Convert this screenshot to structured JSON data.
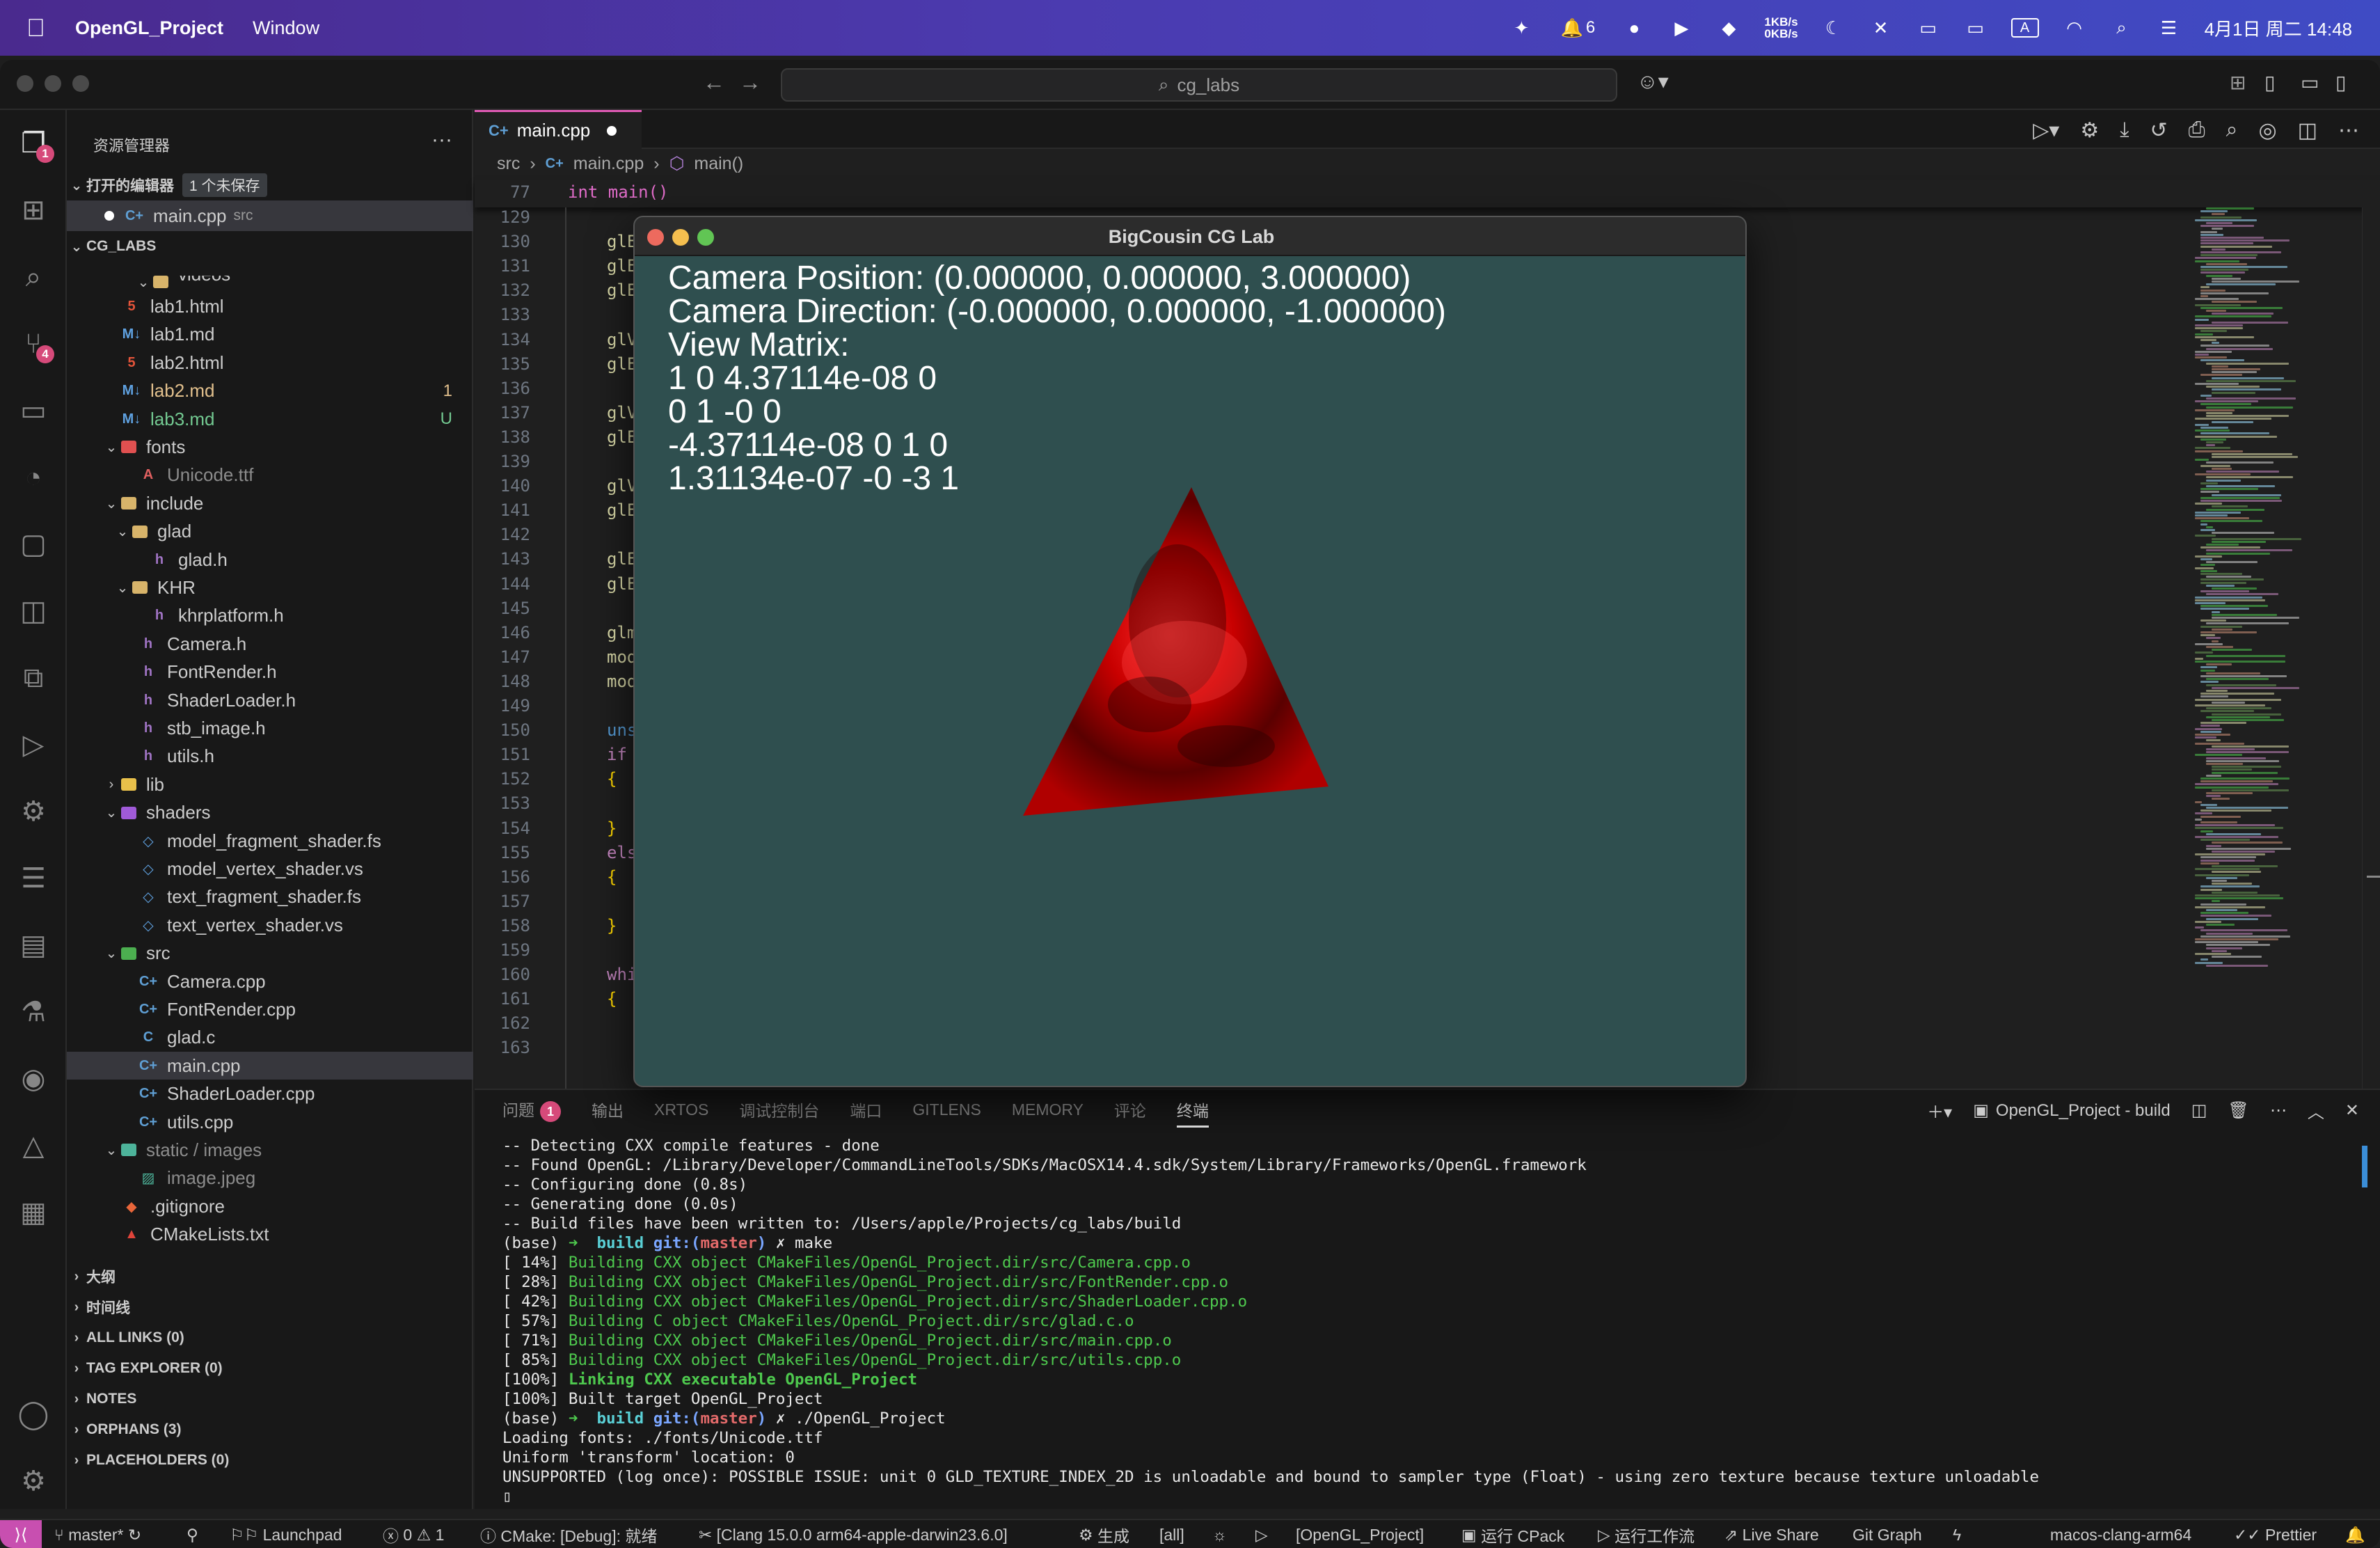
{
  "menubar": {
    "app_name": "OpenGL_Project",
    "menu_window": "Window",
    "network_up": "1KB/s",
    "network_down": "0KB/s",
    "notification_count": "6",
    "input_method": "A",
    "datetime": "4月1日 周二 14:48"
  },
  "titlebar": {
    "search_text": "cg_labs"
  },
  "activity_bar": {
    "explorer_badge": "1",
    "scm_badge": "4"
  },
  "sidebar": {
    "title": "资源管理器",
    "more": "···",
    "open_editors": {
      "label": "打开的编辑器",
      "unsaved_tag": "1 个未保存",
      "file": "main.cpp",
      "file_dir": "src"
    },
    "project": "CG_LABS",
    "tree": [
      {
        "name": "videos",
        "icon": "folder-icon"
      },
      {
        "name": "lab1.html",
        "icon": "html-file-icon"
      },
      {
        "name": "lab1.md",
        "icon": "markdown-file-icon"
      },
      {
        "name": "lab2.html",
        "icon": "html-file-icon"
      },
      {
        "name": "lab2.md",
        "icon": "markdown-file-icon",
        "status": "1"
      },
      {
        "name": "lab3.md",
        "icon": "markdown-file-icon",
        "status": "U"
      },
      {
        "name": "fonts",
        "icon": "folder-icon"
      },
      {
        "name": "Unicode.ttf",
        "icon": "font-file-icon"
      },
      {
        "name": "include",
        "icon": "folder-icon"
      },
      {
        "name": "glad",
        "icon": "folder-icon"
      },
      {
        "name": "glad.h",
        "icon": "header-file-icon"
      },
      {
        "name": "KHR",
        "icon": "folder-icon"
      },
      {
        "name": "khrplatform.h",
        "icon": "header-file-icon"
      },
      {
        "name": "Camera.h",
        "icon": "header-file-icon"
      },
      {
        "name": "FontRender.h",
        "icon": "header-file-icon"
      },
      {
        "name": "ShaderLoader.h",
        "icon": "header-file-icon"
      },
      {
        "name": "stb_image.h",
        "icon": "header-file-icon"
      },
      {
        "name": "utils.h",
        "icon": "header-file-icon"
      },
      {
        "name": "lib",
        "icon": "folder-icon"
      },
      {
        "name": "shaders",
        "icon": "folder-icon"
      },
      {
        "name": "model_fragment_shader.fs",
        "icon": "shader-file-icon"
      },
      {
        "name": "model_vertex_shader.vs",
        "icon": "shader-file-icon"
      },
      {
        "name": "text_fragment_shader.fs",
        "icon": "shader-file-icon"
      },
      {
        "name": "text_vertex_shader.vs",
        "icon": "shader-file-icon"
      },
      {
        "name": "src",
        "icon": "folder-icon"
      },
      {
        "name": "Camera.cpp",
        "icon": "cpp-file-icon"
      },
      {
        "name": "FontRender.cpp",
        "icon": "cpp-file-icon"
      },
      {
        "name": "glad.c",
        "icon": "c-file-icon"
      },
      {
        "name": "main.cpp",
        "icon": "cpp-file-icon"
      },
      {
        "name": "ShaderLoader.cpp",
        "icon": "cpp-file-icon"
      },
      {
        "name": "utils.cpp",
        "icon": "cpp-file-icon"
      },
      {
        "name": "static / images",
        "icon": "folder-icon"
      },
      {
        "name": "image.jpeg",
        "icon": "image-file-icon"
      },
      {
        "name": ".gitignore",
        "icon": "git-file-icon"
      },
      {
        "name": "CMakeLists.txt",
        "icon": "cmake-file-icon"
      }
    ],
    "bottom_sections": [
      "大纲",
      "时间线",
      "ALL LINKS (0)",
      "TAG EXPLORER (0)",
      "NOTES",
      "ORPHANS (3)",
      "PLACEHOLDERS (0)"
    ]
  },
  "editor": {
    "tab_label": "main.cpp",
    "breadcrumb": [
      "src",
      "main.cpp",
      "main()"
    ],
    "sticky_line_number": "77",
    "sticky_code": "int main()",
    "line_numbers": [
      "129",
      "130",
      "131",
      "132",
      "133",
      "134",
      "135",
      "136",
      "137",
      "138",
      "139",
      "140",
      "141",
      "142",
      "143",
      "144",
      "145",
      "146",
      "147",
      "148",
      "149",
      "150",
      "151",
      "152",
      "153",
      "154",
      "155",
      "156",
      "157",
      "158",
      "159",
      "160",
      "161",
      "162",
      "163"
    ],
    "code_fragments": {
      "130": "glE",
      "131": "glE",
      "132": "glE",
      "134": "glV",
      "135": "glE",
      "137": "glV",
      "138": "glE",
      "140": "glV",
      "141": "glE",
      "143": "glE",
      "144": "glE",
      "146": "glm",
      "147": "mod",
      "148": "mod",
      "150": "uns",
      "151": "if",
      "152": "{",
      "154": "}",
      "155": "els",
      "156": "{",
      "158": "}",
      "160": "whi",
      "161": "{"
    }
  },
  "gl_window": {
    "title": "BigCousin CG Lab",
    "lines": [
      "Camera Position: (0.000000, 0.000000, 3.000000)",
      "Camera Direction: (-0.000000, 0.000000, -1.000000)",
      "View Matrix:",
      "1 0 4.37114e-08 0",
      "0 1 -0 0",
      "-4.37114e-08 0 1 0",
      "1.31134e-07 -0 -3 1"
    ],
    "background_color": "#2f4f4f",
    "triangle_color": "#e00000"
  },
  "panel": {
    "tabs": [
      "问题",
      "输出",
      "XRTOS",
      "调试控制台",
      "端口",
      "GITLENS",
      "MEMORY",
      "评论",
      "终端"
    ],
    "problems_badge": "1",
    "terminal_name": "OpenGL_Project - build",
    "terminal_lines": [
      "-- Detecting CXX compile features - done",
      "-- Found OpenGL: /Library/Developer/CommandLineTools/SDKs/MacOSX14.4.sdk/System/Library/Frameworks/OpenGL.framework",
      "-- Configuring done (0.8s)",
      "-- Generating done (0.0s)",
      "-- Build files have been written to: /Users/apple/Projects/cg_labs/build"
    ],
    "prompt1": {
      "base": "(base) ",
      "arrow": "➜  ",
      "dir": "build ",
      "git": "git:(",
      "branch": "master",
      "close": ") ",
      "x": "✗ ",
      "cmd": "make"
    },
    "build_steps": [
      {
        "pct": "[ 14%] ",
        "msg": "Building CXX object CMakeFiles/OpenGL_Project.dir/src/Camera.cpp.o"
      },
      {
        "pct": "[ 28%] ",
        "msg": "Building CXX object CMakeFiles/OpenGL_Project.dir/src/FontRender.cpp.o"
      },
      {
        "pct": "[ 42%] ",
        "msg": "Building CXX object CMakeFiles/OpenGL_Project.dir/src/ShaderLoader.cpp.o"
      },
      {
        "pct": "[ 57%] ",
        "msg": "Building C object CMakeFiles/OpenGL_Project.dir/src/glad.c.o"
      },
      {
        "pct": "[ 71%] ",
        "msg": "Building CXX object CMakeFiles/OpenGL_Project.dir/src/main.cpp.o"
      },
      {
        "pct": "[ 85%] ",
        "msg": "Building CXX object CMakeFiles/OpenGL_Project.dir/src/utils.cpp.o"
      }
    ],
    "link_line": {
      "pct": "[100%] ",
      "msg": "Linking CXX executable OpenGL_Project"
    },
    "built_line": "[100%] Built target OpenGL_Project",
    "prompt2_cmd": "./OpenGL_Project",
    "output_lines": [
      "Loading fonts: ./fonts/Unicode.ttf",
      "Uniform 'transform' location: 0",
      "UNSUPPORTED (log once): POSSIBLE ISSUE: unit 0 GLD_TEXTURE_INDEX_2D is unloadable and bound to sampler type (Float) - using zero texture because texture unloadable"
    ],
    "cursor": "▯"
  },
  "statusbar": {
    "branch": "master*",
    "launchpad": "Launchpad",
    "errors": "0",
    "warnings": "1",
    "info": "1",
    "cmake": "CMake: [Debug]: 就绪",
    "kit": "[Clang 15.0.0 arm64-apple-darwin23.6.0]",
    "build": "生成",
    "target": "[all]",
    "project": "[OpenGL_Project]",
    "ctest": "运行 CPack",
    "workflow": "运行工作流",
    "liveshare": "Live Share",
    "gitgraph": "Git Graph",
    "platform": "macos-clang-arm64",
    "prettier": "Prettier"
  }
}
